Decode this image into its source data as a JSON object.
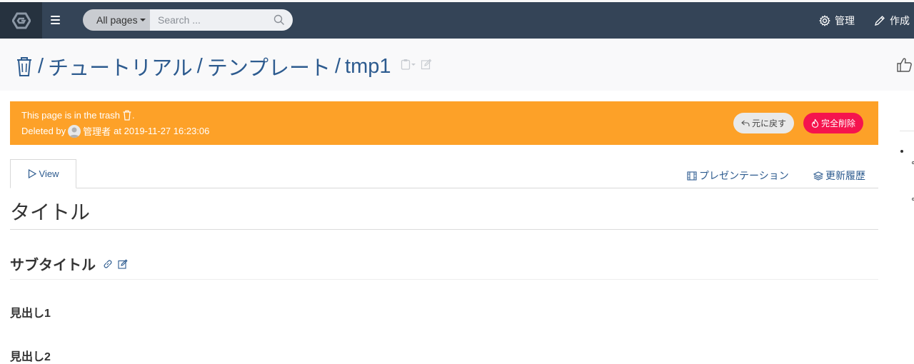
{
  "navbar": {
    "search_scope": "All pages",
    "search_placeholder": "Search ...",
    "admin_label": "管理",
    "create_label": "作成"
  },
  "breadcrumb": {
    "items": [
      "チュートリアル",
      "テンプレート",
      "tmp1"
    ],
    "separator": "/"
  },
  "trash_alert": {
    "line1": "This page is in the trash",
    "line1_suffix": ".",
    "deleted_by_label": "Deleted by",
    "user_name": "管理者",
    "deleted_at": "at 2019-11-27 16:23:06",
    "restore_label": "元に戻す",
    "delete_completely_label": "完全削除"
  },
  "tabs": {
    "view_label": "View",
    "presentation_label": "プレゼンテーション",
    "history_label": "更新履歴"
  },
  "content": {
    "h1": "タイトル",
    "h2": "サブタイトル",
    "h3_1": "見出し1",
    "h3_2": "見出し2"
  },
  "colors": {
    "navbar": "#344457",
    "alert": "#fda128",
    "danger": "#f5144e",
    "link": "#2d5b8f"
  }
}
